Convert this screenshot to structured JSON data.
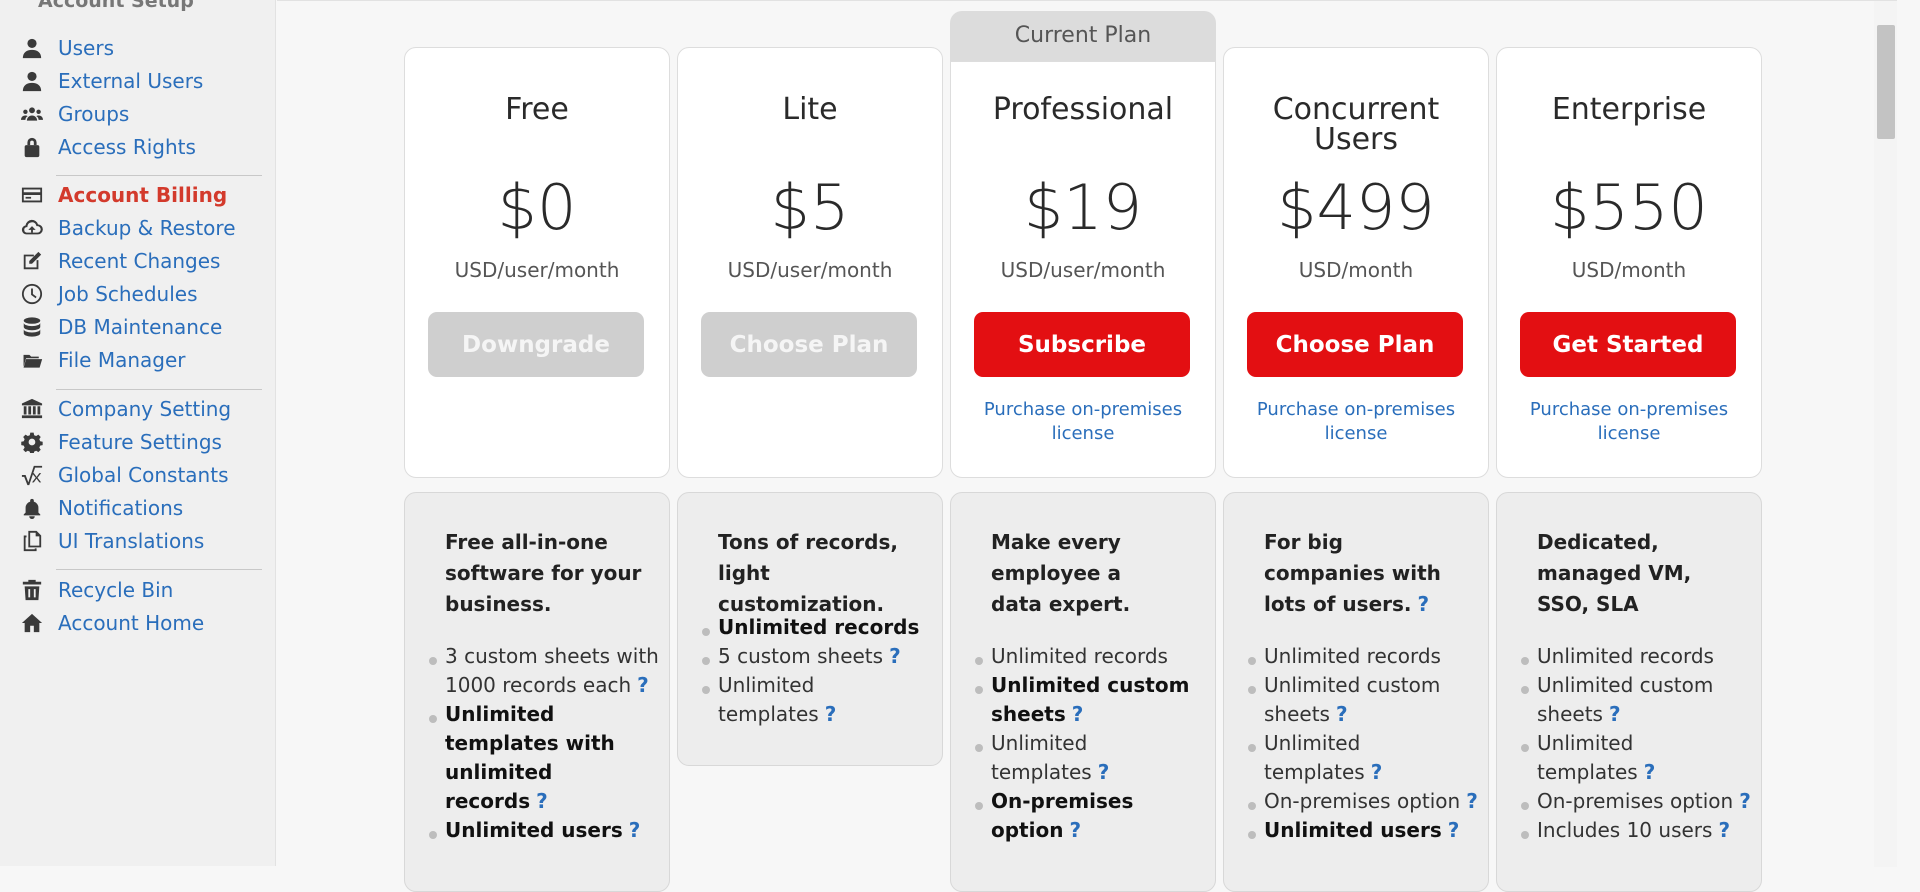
{
  "sidebar": {
    "heading": "Account Setup",
    "items": [
      {
        "label": "Users",
        "icon": "user-icon"
      },
      {
        "label": "External Users",
        "icon": "user-icon"
      },
      {
        "label": "Groups",
        "icon": "users-icon"
      },
      {
        "label": "Access Rights",
        "icon": "lock-icon"
      },
      {
        "label": "Account Billing",
        "icon": "credit-card-icon"
      },
      {
        "label": "Backup & Restore",
        "icon": "cloud-upload-icon"
      },
      {
        "label": "Recent Changes",
        "icon": "edit-icon"
      },
      {
        "label": "Job Schedules",
        "icon": "clock-icon"
      },
      {
        "label": "DB Maintenance",
        "icon": "database-icon"
      },
      {
        "label": "File Manager",
        "icon": "folder-icon"
      },
      {
        "label": "Company Setting",
        "icon": "bank-icon"
      },
      {
        "label": "Feature Settings",
        "icon": "gear-icon"
      },
      {
        "label": "Global Constants",
        "icon": "square-root-icon"
      },
      {
        "label": "Notifications",
        "icon": "bell-icon"
      },
      {
        "label": "UI Translations",
        "icon": "copy-icon"
      },
      {
        "label": "Recycle Bin",
        "icon": "trash-icon"
      },
      {
        "label": "Account Home",
        "icon": "home-icon"
      }
    ]
  },
  "current_plan_label": "Current Plan",
  "plans": [
    {
      "name": "Free",
      "price": "$0",
      "unit": "USD/user/month",
      "button": "Downgrade",
      "license": ""
    },
    {
      "name": "Lite",
      "price": "$5",
      "unit": "USD/user/month",
      "button": "Choose Plan",
      "license": ""
    },
    {
      "name": "Professional",
      "price": "$19",
      "unit": "USD/user/month",
      "button": "Subscribe",
      "license": "Purchase on-premises license"
    },
    {
      "name": "Concurrent Users",
      "price": "$499",
      "unit": "USD/month",
      "button": "Choose Plan",
      "license": "Purchase on-premises license"
    },
    {
      "name": "Enterprise",
      "price": "$550",
      "unit": "USD/month",
      "button": "Get Started",
      "license": "Purchase on-premises license"
    }
  ],
  "features": [
    {
      "tagline": "Free all-in-one software for your business.",
      "items": [
        {
          "text": "3 custom sheets with 1000 records each",
          "bold": false,
          "help": "?"
        },
        {
          "text": "Unlimited templates with unlimited records",
          "bold": true,
          "help": "?"
        },
        {
          "text": "Unlimited users",
          "bold": true,
          "help": "?"
        }
      ]
    },
    {
      "tagline": "Tons of records, light customization.",
      "items": [
        {
          "text": "Unlimited records",
          "bold": true,
          "help": ""
        },
        {
          "text": "5 custom sheets",
          "bold": false,
          "help": "?"
        },
        {
          "text": "Unlimited templates",
          "bold": false,
          "help": "?"
        }
      ]
    },
    {
      "tagline": "Make every employee a data expert.",
      "items": [
        {
          "text": "Unlimited records",
          "bold": false,
          "help": ""
        },
        {
          "text": "Unlimited custom sheets",
          "bold": true,
          "help": "?"
        },
        {
          "text": "Unlimited templates",
          "bold": false,
          "help": "?"
        },
        {
          "text": "On-premises option",
          "bold": true,
          "help": "?"
        }
      ]
    },
    {
      "tagline": "For big companies with lots of users.",
      "tag_help": "?",
      "items": [
        {
          "text": "Unlimited records",
          "bold": false,
          "help": ""
        },
        {
          "text": "Unlimited custom sheets",
          "bold": false,
          "help": "?"
        },
        {
          "text": "Unlimited templates",
          "bold": false,
          "help": "?"
        },
        {
          "text": "On-premises option",
          "bold": false,
          "help": "?"
        },
        {
          "text": "Unlimited users",
          "bold": true,
          "help": "?"
        }
      ]
    },
    {
      "tagline": "Dedicated, managed VM, SSO, SLA",
      "items": [
        {
          "text": "Unlimited records",
          "bold": false,
          "help": ""
        },
        {
          "text": "Unlimited custom sheets",
          "bold": false,
          "help": "?"
        },
        {
          "text": "Unlimited templates",
          "bold": false,
          "help": "?"
        },
        {
          "text": "On-premises option",
          "bold": false,
          "help": "?"
        },
        {
          "text": "Includes 10 users",
          "bold": false,
          "help": "?"
        }
      ]
    }
  ]
}
